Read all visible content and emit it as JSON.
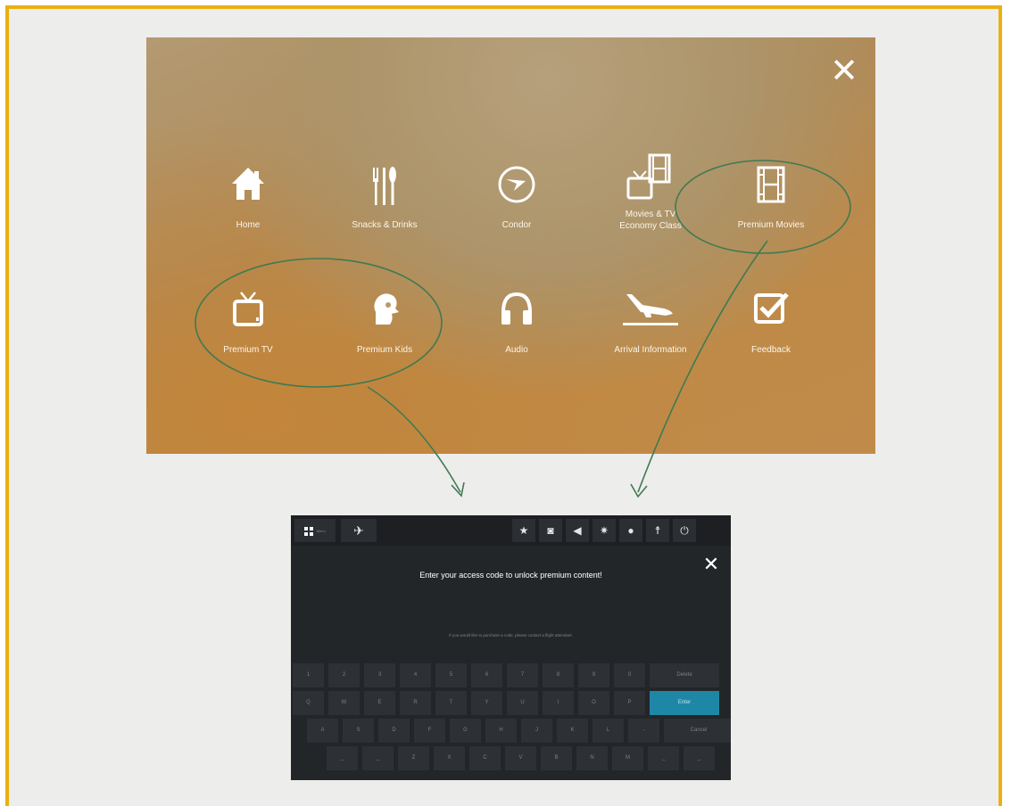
{
  "menu": {
    "close_label": "✕",
    "tiles": [
      {
        "label": "Home",
        "icon": "home-icon"
      },
      {
        "label": "Snacks & Drinks",
        "icon": "cutlery-icon"
      },
      {
        "label": "Condor",
        "icon": "condor-logo-icon"
      },
      {
        "label": "Movies & TV\nEconomy Class",
        "icon": "tv-film-icon"
      },
      {
        "label": "Premium Movies",
        "icon": "film-icon"
      },
      {
        "label": "Premium TV",
        "icon": "tv-icon"
      },
      {
        "label": "Premium Kids",
        "icon": "kids-icon"
      },
      {
        "label": "Audio",
        "icon": "headphones-icon"
      },
      {
        "label": "Arrival Information",
        "icon": "plane-landing-icon"
      },
      {
        "label": "Feedback",
        "icon": "checkbox-icon"
      }
    ]
  },
  "annotation": {
    "color": "#3f7a52"
  },
  "dialog": {
    "topbar": {
      "menu_label": "Menu",
      "plane_icon": "plane-icon",
      "right_icons": [
        "star-icon",
        "chat-icon",
        "volume-icon",
        "brightness-icon",
        "drop-icon",
        "person-icon",
        "power-icon"
      ]
    },
    "close_label": "✕",
    "title": "Enter your access code to unlock premium content!",
    "hint": "If you would like to purchase a code, please contact a flight attendant.",
    "keyboard": {
      "row1": [
        "1",
        "2",
        "3",
        "4",
        "5",
        "6",
        "7",
        "8",
        "9",
        "0",
        "Delete"
      ],
      "row2": [
        "Q",
        "W",
        "E",
        "R",
        "T",
        "Y",
        "U",
        "I",
        "O",
        "P",
        "Enter"
      ],
      "row3": [
        "A",
        "S",
        "D",
        "F",
        "G",
        "H",
        "J",
        "K",
        "L",
        "-",
        "Cancel"
      ],
      "row4": [
        "_",
        "_",
        "Z",
        "X",
        "C",
        "V",
        "B",
        "N",
        "M",
        "_",
        "_"
      ]
    }
  }
}
